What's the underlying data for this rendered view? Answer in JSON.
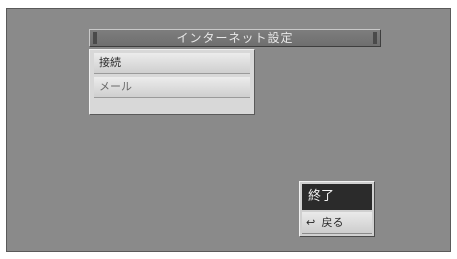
{
  "window": {
    "title": "インターネット設定"
  },
  "menu": {
    "items": [
      {
        "label": "接続"
      },
      {
        "label": "メール"
      }
    ]
  },
  "actions": {
    "finish_label": "終了",
    "back_label": "戻る",
    "back_icon": "return-arrow-icon"
  }
}
